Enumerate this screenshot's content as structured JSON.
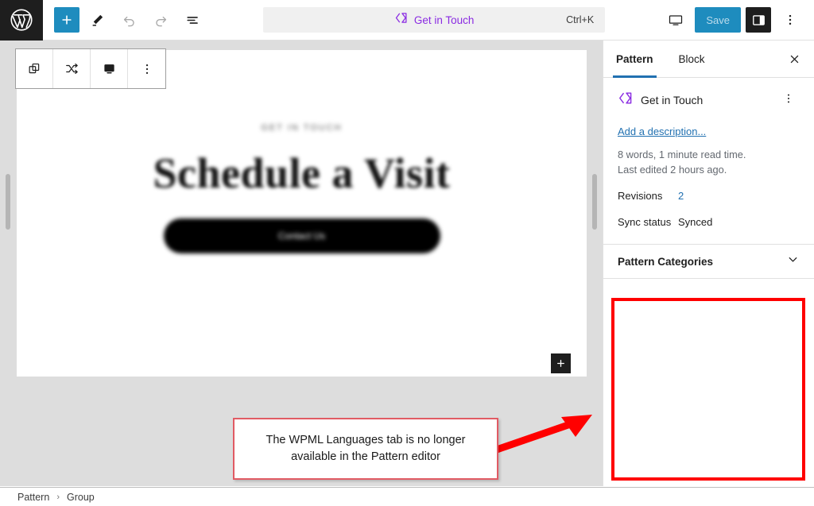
{
  "topbar": {
    "logo_icon": "wordpress-logo-icon",
    "add_block_icon": "plus-icon",
    "edit_mode_icon": "pencil-icon",
    "undo_icon": "undo-arrow-icon",
    "redo_icon": "redo-arrow-icon",
    "list_view_icon": "list-view-icon",
    "view_device_icon": "desktop-preview-icon",
    "sidebar_toggle_icon": "sidebar-panel-icon",
    "options_icon": "three-dots-vertical-icon",
    "pattern_icon": "pattern-diamond-icon",
    "title": "Get in Touch",
    "shortcut": "Ctrl+K",
    "save_label": "Save"
  },
  "block_toolbar": {
    "items": [
      {
        "icon": "copy-blocks-icon",
        "name": "pattern-block-icon"
      },
      {
        "icon": "shuffle-icon",
        "name": "shuffle-pattern-icon"
      },
      {
        "icon": "desktop-icon",
        "name": "display-variation-icon"
      },
      {
        "icon": "three-dots-vertical-icon",
        "name": "block-options-icon"
      }
    ]
  },
  "canvas": {
    "eyebrow": "GET IN TOUCH",
    "headline": "Schedule a Visit",
    "cta_label": "Contact Us",
    "add_block_icon": "plus-icon"
  },
  "callout": {
    "text": "The WPML Languages tab is no longer available in the Pattern editor",
    "border_color": "#e15b64",
    "arrow_color": "#ff0000"
  },
  "sidebar": {
    "tabs": [
      {
        "label": "Pattern",
        "active": true
      },
      {
        "label": "Block",
        "active": false
      }
    ],
    "close_icon": "close-x-icon",
    "pattern": {
      "icon": "pattern-diamond-icon",
      "name": "Get in Touch",
      "more_icon": "three-dots-vertical-icon",
      "description_link": "Add a description...",
      "word_count": "8 words, 1 minute read time.",
      "last_edited": "Last edited 2 hours ago.",
      "revisions_label": "Revisions",
      "revisions_value": "2",
      "sync_label": "Sync status",
      "sync_value": "Synced"
    },
    "categories_section": {
      "title": "Pattern Categories",
      "chevron_icon": "chevron-down-icon"
    },
    "highlight_box": {
      "color": "#ff0000",
      "note": "empty-region-where-wpml-languages-tab-was"
    }
  },
  "breadcrumb": {
    "items": [
      "Pattern",
      "Group"
    ],
    "separator": "›"
  },
  "colors": {
    "accent_blue": "#1e8cbe",
    "pattern_purple": "#8a2be2",
    "link_blue": "#2271b1",
    "editor_bg": "#dddddd",
    "dark": "#1e1e1e"
  }
}
